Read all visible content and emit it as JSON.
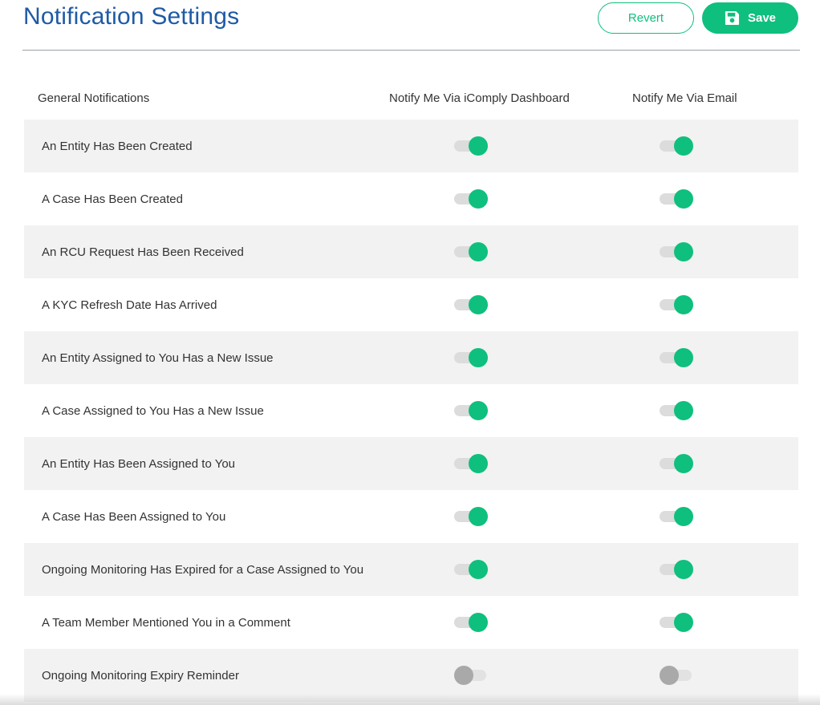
{
  "header": {
    "title": "Notification Settings",
    "revert_label": "Revert",
    "save_label": "Save"
  },
  "columns": {
    "general": "General Notifications",
    "dashboard": "Notify Me Via iComply Dashboard",
    "email": "Notify Me Via Email"
  },
  "rows": [
    {
      "label": "An Entity Has Been Created",
      "dashboard": true,
      "email": true
    },
    {
      "label": "A Case Has Been Created",
      "dashboard": true,
      "email": true
    },
    {
      "label": "An RCU Request Has Been Received",
      "dashboard": true,
      "email": true
    },
    {
      "label": "A KYC Refresh Date Has Arrived",
      "dashboard": true,
      "email": true
    },
    {
      "label": "An Entity Assigned to You Has a New Issue",
      "dashboard": true,
      "email": true
    },
    {
      "label": "A Case Assigned to You Has a New Issue",
      "dashboard": true,
      "email": true
    },
    {
      "label": "An Entity Has Been Assigned to You",
      "dashboard": true,
      "email": true
    },
    {
      "label": "A Case Has Been Assigned to You",
      "dashboard": true,
      "email": true
    },
    {
      "label": "Ongoing Monitoring Has Expired for a Case Assigned to You",
      "dashboard": true,
      "email": true
    },
    {
      "label": "A Team Member Mentioned You in a Comment",
      "dashboard": true,
      "email": true
    },
    {
      "label": "Ongoing Monitoring Expiry Reminder",
      "dashboard": false,
      "email": false
    }
  ],
  "colors": {
    "accent": "#0fbf7e",
    "title": "#1f5aa6",
    "row_shade": "#f2f2f2"
  }
}
